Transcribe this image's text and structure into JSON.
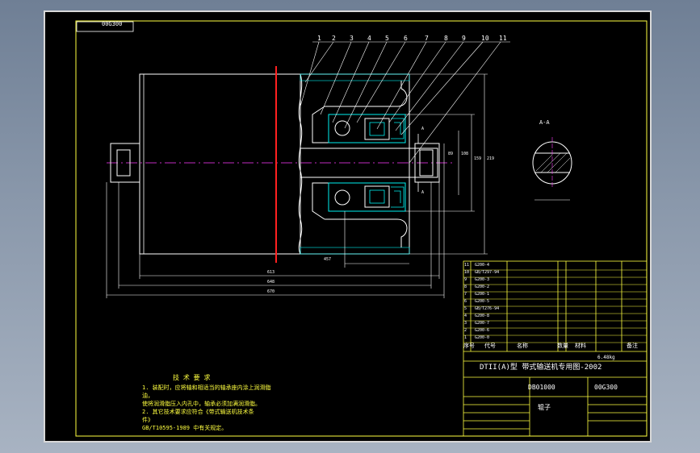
{
  "drawing": {
    "code_tag": "00G300",
    "balloons": [
      "1",
      "2",
      "3",
      "4",
      "5",
      "6",
      "7",
      "8",
      "9",
      "10",
      "11"
    ],
    "section_title": "A-A",
    "section_marks": [
      "A",
      "A"
    ],
    "dims": {
      "d1": "457",
      "d2": "613",
      "d3": "648",
      "d4": "670",
      "v1": "89",
      "v2": "108",
      "v3": "159",
      "v4": "219"
    },
    "tech_req": {
      "title": "技 术 要 求",
      "lines": [
        "1. 装配时，应将轴和相适当的轴承座内涂上润滑脂",
        "油，",
        "   使将润滑脂压入内孔中，轴承必须加满润滑脂。",
        "2. 其它技术要求应符合《带式输送机技术条",
        "件》",
        "   GB/T10595-1989 中有关规定。"
      ]
    },
    "bom": {
      "rows": [
        [
          "11",
          "G200-4",
          "",
          ""
        ],
        [
          "10",
          "GB/T297-94",
          "",
          ""
        ],
        [
          "9",
          "G200-3",
          "",
          ""
        ],
        [
          "8",
          "G200-2",
          "",
          ""
        ],
        [
          "7",
          "G200-1",
          "",
          ""
        ],
        [
          "6",
          "G200-5",
          "",
          ""
        ],
        [
          "5",
          "GB/T276-94",
          "",
          ""
        ],
        [
          "4",
          "G200-8",
          "",
          ""
        ],
        [
          "3",
          "G200-7",
          "",
          ""
        ],
        [
          "2",
          "G200-6",
          "",
          ""
        ],
        [
          "1",
          "G200-0",
          "",
          ""
        ]
      ],
      "header": [
        "序号",
        "代号",
        "名称",
        "数量",
        "材料",
        "备注"
      ],
      "weight_label": "6.48kg",
      "series_title": "DTII(A)型 带式输送机专用图-2002",
      "drawing_no": "DB01000",
      "code": "00G300",
      "part_name": "辊子"
    }
  }
}
